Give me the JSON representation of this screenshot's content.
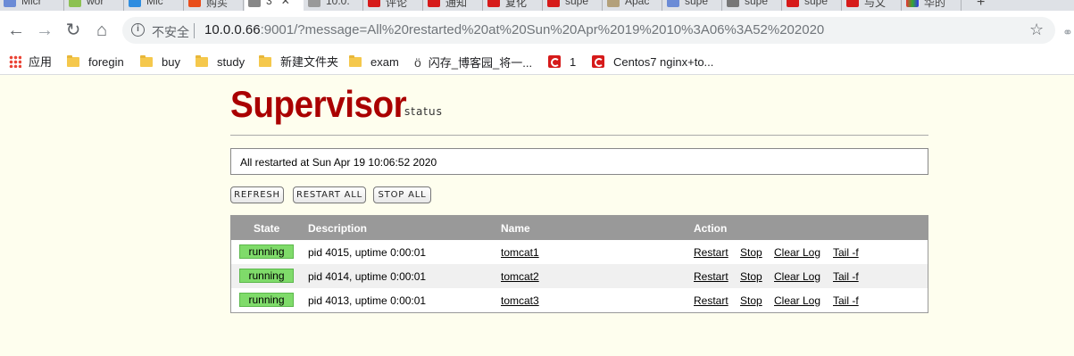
{
  "browser": {
    "tabs": [
      "Micr",
      "wor",
      "Mic",
      "购买",
      "3",
      "10.0.",
      "评论",
      "通知",
      "复化",
      "supe",
      "Apac",
      "supe",
      "supe",
      "supe",
      "与文",
      "华的"
    ],
    "url_host": "10.0.0.66",
    "url_rest": ":9001/?message=All%20restarted%20at%20Sun%20Apr%2019%2010%3A06%3A52%202020",
    "security_label": "不安全",
    "bookmarks": [
      "应用",
      "foregin",
      "buy",
      "study",
      "新建文件夹",
      "exam",
      "闪存_博客园_将一...",
      "1",
      "Centos7 nginx+to..."
    ]
  },
  "page": {
    "logo": "Supervisor",
    "logo_sub": "status",
    "message": "All restarted at Sun Apr 19 10:06:52 2020",
    "buttons": {
      "refresh": "REFRESH",
      "restart_all": "RESTART ALL",
      "stop_all": "STOP ALL"
    },
    "table": {
      "headers": {
        "state": "State",
        "description": "Description",
        "name": "Name",
        "action": "Action"
      },
      "rows": [
        {
          "state": "running",
          "description": "pid 4015, uptime 0:00:01",
          "name": "tomcat1"
        },
        {
          "state": "running",
          "description": "pid 4014, uptime 0:00:01",
          "name": "tomcat2"
        },
        {
          "state": "running",
          "description": "pid 4013, uptime 0:00:01",
          "name": "tomcat3"
        }
      ],
      "actions": {
        "restart": "Restart",
        "stop": "Stop",
        "clear_log": "Clear Log",
        "tail": "Tail -f"
      }
    }
  },
  "colors": {
    "logo": "#aa0000",
    "running": "#7fdb6a",
    "header": "#999999",
    "background": "#fefeee"
  }
}
